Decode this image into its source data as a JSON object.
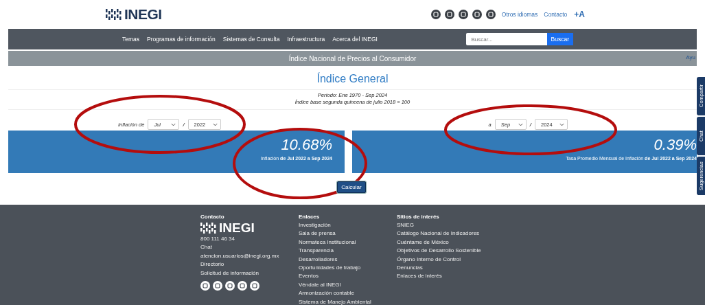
{
  "header": {
    "logo": "INEGI",
    "links": [
      "Otros idiomas",
      "Contacto"
    ],
    "font_size_button": "+A"
  },
  "nav": {
    "items": [
      "Temas",
      "Programas de información",
      "Sistemas de Consulta",
      "Infraestructura",
      "Acerca del INEGI"
    ],
    "search": {
      "placeholder": "Buscar...",
      "button": "Buscar"
    }
  },
  "subheader": {
    "title": "Índice Nacional de Precios al Consumidor",
    "help_link": "Ayu"
  },
  "page_title": "Índice General",
  "period": [
    "Período: Ene 1970 - Sep 2024",
    "Índice base segunda quincena de julio 2018 = 100"
  ],
  "from": {
    "label": "Inflación de",
    "month": "Jul",
    "separator": "/",
    "year": "2022"
  },
  "to": {
    "label": "a",
    "month": "Sep",
    "separator": "/",
    "year": "2024"
  },
  "results": [
    {
      "value": "10.68%",
      "caption": "Inflación **de Jul 2022 a Sep 2024**"
    },
    {
      "value": "0.39%",
      "caption": "Tasa Promedio Mensual de Inflación **de Jul 2022 a Sep 2024**"
    }
  ],
  "calculate_button": "Calcular",
  "side_tabs": [
    "Compartir",
    "Chat",
    "Sugerencias"
  ],
  "footer": {
    "contact": {
      "heading": "Contacto",
      "logo": "INEGI",
      "lines": [
        "800 111 46 34",
        "Chat",
        "atencion.usuarios@inegi.org.mx",
        "Directorio",
        "Solicitud de información"
      ]
    },
    "columns": [
      {
        "heading": "Enlaces",
        "links": [
          "Investigación",
          "Sala de prensa",
          "Normateca Institucional",
          "Transparencia",
          "Desarrolladores",
          "Oportunidades de trabajo",
          "Eventos",
          "Véndale al INEGI",
          "Armonización contable",
          "Sistema de Manejo Ambiental"
        ]
      },
      {
        "heading": "Sitios de interés",
        "links": [
          "SNIEG",
          "Catálogo Nacional de Indicadores",
          "Cuéntame de México",
          "Objetivos de Desarrollo Sostenible",
          "Órgano Interno de Control",
          "Denuncias",
          "Enlaces de interés"
        ]
      }
    ]
  }
}
